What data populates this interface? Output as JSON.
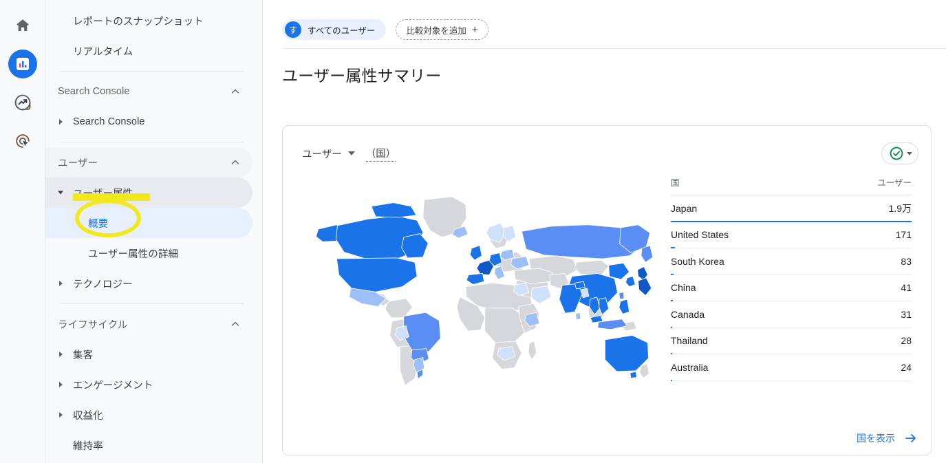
{
  "rail": {
    "items": [
      {
        "name": "home-icon",
        "label": "ホーム",
        "active": false
      },
      {
        "name": "reports-icon",
        "label": "レポート",
        "active": true
      },
      {
        "name": "explore-icon",
        "label": "探索",
        "active": false
      },
      {
        "name": "advertising-icon",
        "label": "広告",
        "active": false
      }
    ]
  },
  "sidebar": {
    "items": [
      {
        "label": "レポートのスナップショット",
        "type": "plain"
      },
      {
        "label": "リアルタイム",
        "type": "plain"
      },
      {
        "label": "Search Console",
        "type": "section"
      },
      {
        "label": "Search Console",
        "type": "collapsed"
      },
      {
        "label": "ユーザー",
        "type": "section-shaded"
      },
      {
        "label": "ユーザー属性",
        "type": "group-open"
      },
      {
        "label": "概要",
        "type": "selected"
      },
      {
        "label": "ユーザー属性の詳細",
        "type": "sub"
      },
      {
        "label": "テクノロジー",
        "type": "collapsed"
      },
      {
        "label": "ライフサイクル",
        "type": "section"
      },
      {
        "label": "集客",
        "type": "collapsed"
      },
      {
        "label": "エンゲージメント",
        "type": "collapsed"
      },
      {
        "label": "収益化",
        "type": "collapsed"
      },
      {
        "label": "維持率",
        "type": "plain"
      }
    ]
  },
  "topbar": {
    "segment_initial": "す",
    "segment_label": "すべてのユーザー",
    "compare_label": "比較対象を追加",
    "compare_plus": "+"
  },
  "page": {
    "title": "ユーザー属性サマリー"
  },
  "card": {
    "metric_label": "ユーザー",
    "dimension_label": "（国）",
    "footer_link": "国を表示",
    "status_icon": "check-circle-icon"
  },
  "chart_data": {
    "type": "table",
    "title": "ユーザー属性サマリー",
    "subtitle": "ユーザー（国）",
    "columns": [
      "国",
      "ユーザー"
    ],
    "xlabel": "国",
    "ylabel": "ユーザー",
    "categories": [
      "Japan",
      "United States",
      "South Korea",
      "China",
      "Canada",
      "Thailand",
      "Australia"
    ],
    "values": [
      19000,
      171,
      83,
      41,
      31,
      28,
      24
    ],
    "value_labels": [
      "1.9万",
      "171",
      "83",
      "41",
      "31",
      "28",
      "24"
    ],
    "bar_percents": [
      100,
      0.9,
      0.44,
      0.22,
      0.16,
      0.15,
      0.13
    ],
    "legend": "position: none",
    "grid": false,
    "map": {
      "type": "choropleth",
      "scale_colors": [
        "#d5d7da",
        "#cfe0fb",
        "#9dbff7",
        "#5b8ef4",
        "#1a73e8",
        "#1158c7"
      ],
      "no_data_color": "#d5d7da",
      "highlighted_regions": [
        {
          "region": "Japan",
          "level": 5
        },
        {
          "region": "China",
          "level": 4
        },
        {
          "region": "United States",
          "level": 4
        },
        {
          "region": "Canada",
          "level": 4
        },
        {
          "region": "Australia",
          "level": 4
        },
        {
          "region": "South Korea",
          "level": 4
        },
        {
          "region": "Thailand",
          "level": 4
        },
        {
          "region": "India",
          "level": 4
        },
        {
          "region": "France",
          "level": 5
        },
        {
          "region": "Germany",
          "level": 4
        },
        {
          "region": "United Kingdom",
          "level": 4
        },
        {
          "region": "Russia",
          "level": 3
        },
        {
          "region": "Brazil",
          "level": 3
        },
        {
          "region": "Mexico",
          "level": 2
        },
        {
          "region": "Indonesia",
          "level": 3
        },
        {
          "region": "Vietnam",
          "level": 4
        }
      ]
    }
  },
  "annotations": [
    {
      "kind": "highlighter-underline",
      "target": "ユーザー属性"
    },
    {
      "kind": "highlighter-ellipse",
      "target": "概要"
    }
  ]
}
